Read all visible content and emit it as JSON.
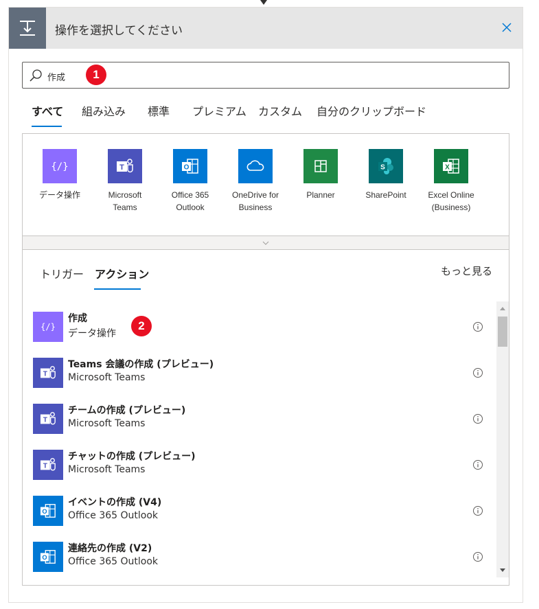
{
  "header": {
    "title": "操作を選択してください"
  },
  "search": {
    "value": "作成"
  },
  "badges": {
    "one": "1",
    "two": "2"
  },
  "category_tabs": [
    "すべて",
    "組み込み",
    "標準",
    "プレミアム",
    "カスタム",
    "自分のクリップボード"
  ],
  "active_category": "すべて",
  "connectors": [
    {
      "label": "データ操作",
      "icon": "data-operation-icon",
      "color": "#8c6cff"
    },
    {
      "label": "Microsoft\nTeams",
      "icon": "teams-icon",
      "color": "#4b53bc"
    },
    {
      "label": "Office 365\nOutlook",
      "icon": "outlook-icon",
      "color": "#0078d4"
    },
    {
      "label": "OneDrive for\nBusiness",
      "icon": "onedrive-icon",
      "color": "#0078d4"
    },
    {
      "label": "Planner",
      "icon": "planner-icon",
      "color": "#1f8a46"
    },
    {
      "label": "SharePoint",
      "icon": "sharepoint-icon",
      "color": "#036c70"
    },
    {
      "label": "Excel Online\n(Business)",
      "icon": "excel-icon",
      "color": "#107c41"
    }
  ],
  "sub_tabs": {
    "trigger": "トリガー",
    "action": "アクション",
    "active": "アクション"
  },
  "see_more": "もっと見る",
  "actions": [
    {
      "title": "作成",
      "connector": "データ操作",
      "icon": "data-operation-icon",
      "color": "#8c6cff"
    },
    {
      "title": "Teams 会議の作成 (プレビュー)",
      "connector": "Microsoft Teams",
      "icon": "teams-icon",
      "color": "#4b53bc"
    },
    {
      "title": "チームの作成 (プレビュー)",
      "connector": "Microsoft Teams",
      "icon": "teams-icon",
      "color": "#4b53bc"
    },
    {
      "title": "チャットの作成 (プレビュー)",
      "connector": "Microsoft Teams",
      "icon": "teams-icon",
      "color": "#4b53bc"
    },
    {
      "title": "イベントの作成 (V4)",
      "connector": "Office 365 Outlook",
      "icon": "outlook-icon",
      "color": "#0078d4"
    },
    {
      "title": "連絡先の作成 (V2)",
      "connector": "Office 365 Outlook",
      "icon": "outlook-icon",
      "color": "#0078d4"
    }
  ],
  "colors": {
    "accent": "#0078d4",
    "badge": "#e81123",
    "header_bg": "#e6e6e6",
    "header_icon_bg": "#616d7c"
  }
}
